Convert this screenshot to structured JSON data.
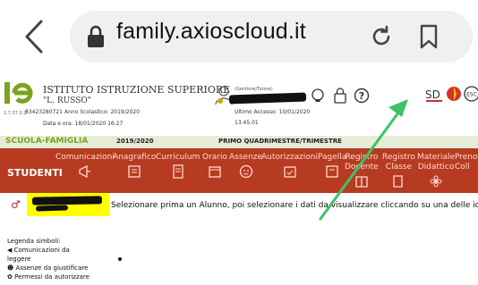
{
  "browser": {
    "url": "family.axioscloud.it"
  },
  "header": {
    "school_line1": "ISTITUTO ISTRUZIONE SUPERIORE",
    "school_line2": "\"L. RUSSO\"",
    "version": "1.7.07.0.2",
    "code": "83423280721",
    "year_label": "Anno Scolastico: 2019/2020",
    "datetime": "Data e ora: 18/01/2020 16:27",
    "user_role": "(Genitore/Tutore)",
    "last_access_label": "Ultimo Accesso: 10/01/2020",
    "last_access_time": "13.45.01",
    "sd_label": "SD"
  },
  "strip": {
    "section": "SCUOLA-FAMIGLIA",
    "year": "2019/2020",
    "period": "PRIMO QUADRIMESTRE/TRIMESTRE"
  },
  "nav": {
    "students": "STUDENTI",
    "items": [
      {
        "label1": "Comunicazioni",
        "label2": ""
      },
      {
        "label1": "Anagrafico",
        "label2": ""
      },
      {
        "label1": "Curriculum",
        "label2": ""
      },
      {
        "label1": "Orario",
        "label2": ""
      },
      {
        "label1": "Assenze",
        "label2": ""
      },
      {
        "label1": "Autorizzazioni",
        "label2": ""
      },
      {
        "label1": "Pagella",
        "label2": ""
      },
      {
        "label1": "Registro",
        "label2": "Docente"
      },
      {
        "label1": "Registro",
        "label2": "Classe"
      },
      {
        "label1": "Materiale",
        "label2": "Didattico"
      },
      {
        "label1": "Prenot",
        "label2": "Coll"
      }
    ]
  },
  "main": {
    "instructions": "Selezionare prima un Alunno, poi selezionare i dati da visualizzare cliccando su una delle icone"
  },
  "legend": {
    "title": "Legenda simboli:",
    "item1a": "Comunicazioni da",
    "item1b": "leggere",
    "item2": "Assenze da giustificare",
    "item3": "Permessi da autorizzare"
  },
  "colors": {
    "nav_bg": "#b73b21",
    "strip_bg": "#e7ecd6",
    "accent_green": "#7aa31c",
    "highlight": "#ffff00",
    "arrow": "#3cc36a"
  }
}
